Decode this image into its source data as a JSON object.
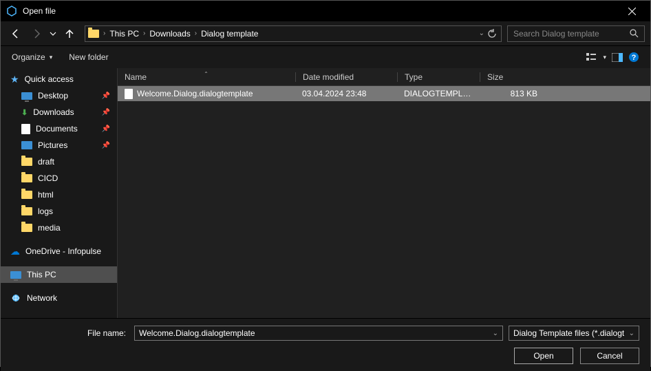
{
  "title": "Open file",
  "breadcrumb": [
    "This PC",
    "Downloads",
    "Dialog template"
  ],
  "search_placeholder": "Search Dialog template",
  "toolbar": {
    "organize": "Organize",
    "new_folder": "New folder"
  },
  "columns": {
    "name": "Name",
    "date": "Date modified",
    "type": "Type",
    "size": "Size"
  },
  "files": [
    {
      "name": "Welcome.Dialog.dialogtemplate",
      "date": "03.04.2024 23:48",
      "type": "DIALOGTEMPLATE...",
      "size": "813 KB"
    }
  ],
  "sidebar": {
    "quick_access": "Quick access",
    "items": [
      {
        "label": "Desktop",
        "pinned": true
      },
      {
        "label": "Downloads",
        "pinned": true
      },
      {
        "label": "Documents",
        "pinned": true
      },
      {
        "label": "Pictures",
        "pinned": true
      },
      {
        "label": "draft",
        "pinned": false
      },
      {
        "label": "CICD",
        "pinned": false
      },
      {
        "label": "html",
        "pinned": false
      },
      {
        "label": "logs",
        "pinned": false
      },
      {
        "label": "media",
        "pinned": false
      }
    ],
    "onedrive": "OneDrive - Infopulse",
    "this_pc": "This PC",
    "network": "Network"
  },
  "filename_label": "File name:",
  "filename_value": "Welcome.Dialog.dialogtemplate",
  "filetype": "Dialog Template files  (*.dialogt",
  "buttons": {
    "open": "Open",
    "cancel": "Cancel"
  }
}
